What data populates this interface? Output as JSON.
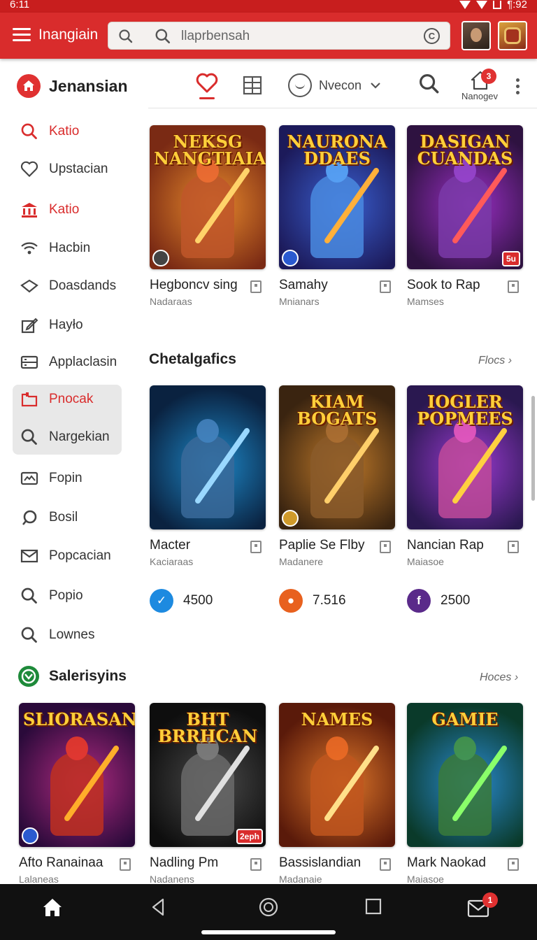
{
  "status_bar": {
    "time": "6:11",
    "right_text": "¶:92"
  },
  "app_bar": {
    "title": "Inangiain",
    "search_placeholder": "llaprbensah",
    "clear_glyph": "C"
  },
  "toolbar": {
    "brand_title": "Jenansian",
    "dropdown_label": "Nvecon",
    "home_badge": "3",
    "home_label": "Nanogev"
  },
  "sidebar": {
    "items": [
      {
        "label": "Katio",
        "icon": "search-icon",
        "active": true
      },
      {
        "label": "Upstacian",
        "icon": "heart-icon"
      },
      {
        "label": "Katio",
        "icon": "bank-icon",
        "active": true
      },
      {
        "label": "Hacbin",
        "icon": "wifi-icon"
      },
      {
        "label": "Doasdands",
        "icon": "diamond-icon"
      },
      {
        "label": "Hayło",
        "icon": "edit-icon"
      },
      {
        "label": "Applaclasin",
        "icon": "list-icon"
      },
      {
        "label": "Pnocak",
        "icon": "folder-icon",
        "active": true
      },
      {
        "label": "Nargekian",
        "icon": "search-icon"
      },
      {
        "label": "Fopin",
        "icon": "picture-icon"
      },
      {
        "label": "Bosil",
        "icon": "circle-icon"
      },
      {
        "label": "Popcacian",
        "icon": "mail-icon"
      },
      {
        "label": "Popio",
        "icon": "search-icon"
      },
      {
        "label": "Lownes",
        "icon": "search-icon"
      }
    ]
  },
  "row1": {
    "cards": [
      {
        "art_title": "NEKSG NANGTIAIA",
        "name": "Hegboncv sing",
        "sub": "Nadaraas",
        "badge_r": ""
      },
      {
        "art_title": "NAURONA DDAES",
        "name": "Samahy",
        "sub": "Mnianars",
        "badge_r": ""
      },
      {
        "art_title": "DASIGAN CUANDAS",
        "name": "Sook to Rap",
        "sub": "Mamses",
        "badge_r": "5u"
      }
    ]
  },
  "section2": {
    "title": "Chetalgafics",
    "more": "Flocs",
    "cards": [
      {
        "art_title": "",
        "name": "Macter",
        "sub": "Kaciaraas",
        "stat": "4500",
        "stat_icon": "twitter-icon"
      },
      {
        "art_title": "KIAM BOGATS",
        "name": "Paplie Se Flby",
        "sub": "Madanere",
        "stat": "7.516",
        "stat_icon": "fire-icon"
      },
      {
        "art_title": "IOGLER POPMEES",
        "name": "Nancian Rap",
        "sub": "Maiasoe",
        "stat": "2500",
        "stat_icon": "f-icon"
      }
    ]
  },
  "section3": {
    "title": "Salerisyins",
    "more": "Hoces",
    "cards": [
      {
        "art_title": "SLIORASAN",
        "name": "Afto Ranainaa",
        "sub": "Lalaneas",
        "badge_r": ""
      },
      {
        "art_title": "BHT BRRHCAN",
        "name": "Nadling Pm",
        "sub": "Nadanens",
        "badge_r": "2eph"
      },
      {
        "art_title": "NAMES",
        "name": "Bassislandian",
        "sub": "Madanaie",
        "badge_r": ""
      },
      {
        "art_title": "GAMIE",
        "name": "Mark Naokad",
        "sub": "Maiasoe",
        "badge_r": ""
      }
    ]
  },
  "nav_bar": {
    "mail_badge": "1"
  },
  "colors": {
    "primary": "#d92c2c",
    "accent_green": "#1e8a3a"
  }
}
